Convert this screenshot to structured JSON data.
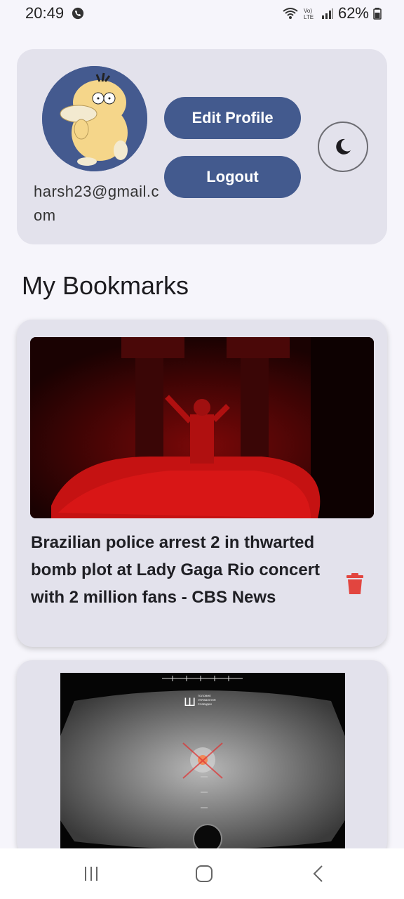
{
  "status_bar": {
    "time": "20:49",
    "battery": "62%",
    "icons": [
      "call-icon",
      "wifi-icon",
      "volte-icon",
      "signal-icon",
      "battery-icon"
    ]
  },
  "profile": {
    "email": "harsh23@gmail.com",
    "edit_profile_label": "Edit Profile",
    "logout_label": "Logout",
    "theme_icon": "moon-icon",
    "avatar_bg": "#445a8f"
  },
  "bookmarks": {
    "title": "My Bookmarks",
    "items": [
      {
        "title": "Brazilian police arrest 2 in thwarted bomb plot at Lady Gaga Rio concert with 2 million fans - CBS News",
        "delete_icon": "trash-icon"
      },
      {
        "title": "",
        "image_text": [
          "ГОЛОВНЕ",
          "УПРАВЛІННЯ",
          "РОЗВІДКИ"
        ],
        "ad_close": "×"
      }
    ]
  },
  "nav_bar": {
    "icons": [
      "recents-icon",
      "home-icon",
      "back-icon"
    ]
  },
  "colors": {
    "primary": "#435a8e",
    "card_bg": "#e3e2ec",
    "page_bg": "#f6f5fb",
    "delete": "#e2453f"
  }
}
